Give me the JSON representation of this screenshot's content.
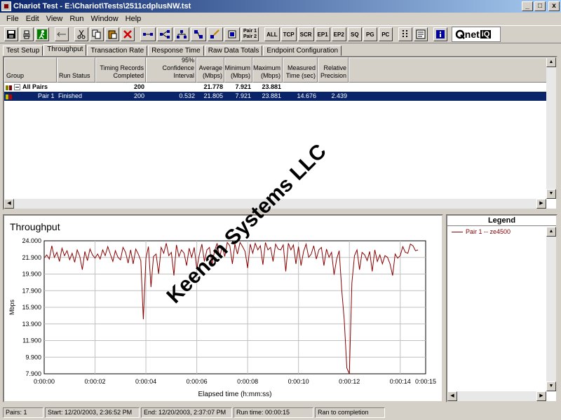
{
  "window": {
    "title": "Chariot Test - E:\\Chariot\\Tests\\2511cdplusNW.tst",
    "minimize_glyph": "_",
    "maximize_glyph": "□",
    "close_glyph": "x"
  },
  "menu": {
    "file": "File",
    "edit": "Edit",
    "view": "View",
    "run": "Run",
    "window": "Window",
    "help": "Help"
  },
  "toolbar": {
    "buttons": [
      "ALL",
      "TCP",
      "SCR",
      "EP1",
      "EP2",
      "SQ",
      "PG",
      "PC"
    ],
    "pair1": "Pair 1",
    "pair2": "Pair 2",
    "brand": "net",
    "brand_suffix": "iQ"
  },
  "tabs": [
    "Test Setup",
    "Throughput",
    "Transaction Rate",
    "Response Time",
    "Raw Data Totals",
    "Endpoint Configuration"
  ],
  "grid": {
    "headers": {
      "group": "Group",
      "run_status": "Run Status",
      "timing_records_l1": "Timing Records",
      "timing_records_l2": "Completed",
      "confidence_l1": "95% Confidence",
      "confidence_l2": "Interval",
      "average_l1": "Average",
      "average_l2": "(Mbps)",
      "minimum_l1": "Minimum",
      "minimum_l2": "(Mbps)",
      "maximum_l1": "Maximum",
      "maximum_l2": "(Mbps)",
      "measured_l1": "Measured",
      "measured_l2": "Time (sec)",
      "relative_l1": "Relative",
      "relative_l2": "Precision"
    },
    "rows": [
      {
        "group": "All Pairs",
        "status": "",
        "records": "200",
        "confidence": "",
        "average": "21.778",
        "minimum": "7.921",
        "maximum": "23.881",
        "measured": "",
        "precision": ""
      },
      {
        "group": "Pair 1",
        "status": "Finished",
        "records": "200",
        "confidence": "0.532",
        "average": "21.805",
        "minimum": "7.921",
        "maximum": "23.881",
        "measured": "14.676",
        "precision": "2.439"
      }
    ]
  },
  "chart_data": {
    "type": "line",
    "title": "Throughput",
    "xlabel": "Elapsed time (h:mm:ss)",
    "ylabel": "Mbps",
    "xlim": [
      0,
      15
    ],
    "ylim": [
      7.9,
      24.0
    ],
    "yticks": [
      "24.000",
      "21.900",
      "19.900",
      "17.900",
      "15.900",
      "13.900",
      "11.900",
      "9.900",
      "7.900"
    ],
    "xticks": [
      "0:00:00",
      "0:00:02",
      "0:00:04",
      "0:00:06",
      "0:00:08",
      "0:00:10",
      "0:00:12",
      "0:00:14",
      "0:00:15"
    ],
    "grid": true,
    "series": [
      {
        "name": "Pair 1 -- ze4500",
        "color": "#8b0000",
        "x": [
          0.0,
          0.1,
          0.2,
          0.3,
          0.4,
          0.5,
          0.6,
          0.7,
          0.8,
          0.9,
          1.0,
          1.1,
          1.2,
          1.3,
          1.4,
          1.5,
          1.6,
          1.7,
          1.8,
          1.9,
          2.0,
          2.1,
          2.2,
          2.3,
          2.4,
          2.5,
          2.6,
          2.7,
          2.8,
          2.9,
          3.0,
          3.1,
          3.2,
          3.3,
          3.4,
          3.5,
          3.6,
          3.7,
          3.8,
          3.9,
          4.0,
          4.1,
          4.2,
          4.3,
          4.4,
          4.5,
          4.6,
          4.7,
          4.8,
          4.9,
          5.0,
          5.1,
          5.2,
          5.3,
          5.4,
          5.5,
          5.6,
          5.7,
          5.8,
          5.9,
          6.0,
          6.1,
          6.2,
          6.3,
          6.4,
          6.5,
          6.6,
          6.7,
          6.8,
          6.9,
          7.0,
          7.1,
          7.2,
          7.3,
          7.4,
          7.5,
          7.6,
          7.7,
          7.8,
          7.9,
          8.0,
          8.1,
          8.2,
          8.3,
          8.4,
          8.5,
          8.6,
          8.7,
          8.8,
          8.9,
          9.0,
          9.1,
          9.2,
          9.3,
          9.4,
          9.5,
          9.6,
          9.7,
          9.8,
          9.9,
          10.0,
          10.1,
          10.2,
          10.3,
          10.4,
          10.5,
          10.6,
          10.7,
          10.8,
          10.9,
          11.0,
          11.1,
          11.2,
          11.3,
          11.4,
          11.5,
          11.6,
          11.7,
          11.8,
          11.9,
          12.0,
          12.1,
          12.2,
          12.3,
          12.4,
          12.5,
          12.6,
          12.7,
          12.8,
          12.9,
          13.0,
          13.1,
          13.2,
          13.3,
          13.4,
          13.5,
          13.6,
          13.7,
          13.8,
          13.9,
          14.0,
          14.1,
          14.2,
          14.3,
          14.4,
          14.5,
          14.6,
          14.7
        ],
        "values": [
          21.9,
          22.3,
          21.8,
          23.4,
          22.0,
          22.6,
          21.5,
          23.1,
          22.2,
          22.8,
          21.7,
          22.5,
          21.4,
          22.9,
          22.1,
          20.5,
          22.7,
          21.6,
          23.0,
          22.3,
          21.9,
          22.4,
          21.8,
          22.9,
          22.2,
          23.3,
          22.4,
          21.5,
          22.8,
          22.0,
          21.7,
          23.2,
          22.6,
          21.3,
          22.9,
          21.2,
          23.0,
          22.4,
          21.6,
          14.5,
          21.9,
          23.3,
          18.4,
          22.1,
          22.4,
          20.0,
          23.2,
          22.5,
          23.7,
          22.2,
          22.6,
          19.8,
          23.5,
          22.1,
          22.9,
          22.5,
          21.0,
          23.1,
          22.0,
          23.2,
          20.6,
          22.3,
          23.6,
          21.5,
          22.9,
          23.2,
          21.1,
          22.8,
          23.7,
          22.0,
          23.3,
          22.1,
          23.8,
          23.4,
          21.2,
          23.6,
          22.4,
          23.8,
          23.3,
          22.7,
          20.7,
          23.6,
          22.5,
          23.7,
          22.9,
          23.4,
          21.1,
          23.8,
          22.9,
          23.2,
          21.5,
          23.6,
          23.0,
          22.9,
          23.5,
          20.3,
          23.7,
          22.9,
          23.5,
          21.2,
          23.3,
          21.0,
          22.7,
          23.6,
          22.0,
          22.4,
          23.4,
          21.8,
          22.9,
          23.2,
          21.0,
          23.0,
          22.0,
          22.6,
          19.9,
          21.8,
          22.8,
          18.1,
          14.4,
          8.6,
          7.9,
          18.9,
          22.2,
          22.9,
          20.5,
          22.6,
          22.3,
          21.6,
          22.7,
          20.3,
          22.9,
          21.5,
          22.3,
          21.2,
          22.2,
          22.0,
          21.2,
          19.8,
          22.4,
          21.9,
          22.2,
          23.3,
          22.6,
          22.5,
          23.6,
          23.4,
          22.8,
          22.9
        ]
      }
    ]
  },
  "legend": {
    "title": "Legend",
    "entries": [
      "Pair 1 -- ze4500"
    ]
  },
  "watermark": "Keenan Systems LLC",
  "status": {
    "pairs": "Pairs: 1",
    "start": "Start: 12/20/2003, 2:36:52 PM",
    "end": "End: 12/20/2003, 2:37:07 PM",
    "run_time": "Run time: 00:00:15",
    "result": "Ran to completion"
  }
}
